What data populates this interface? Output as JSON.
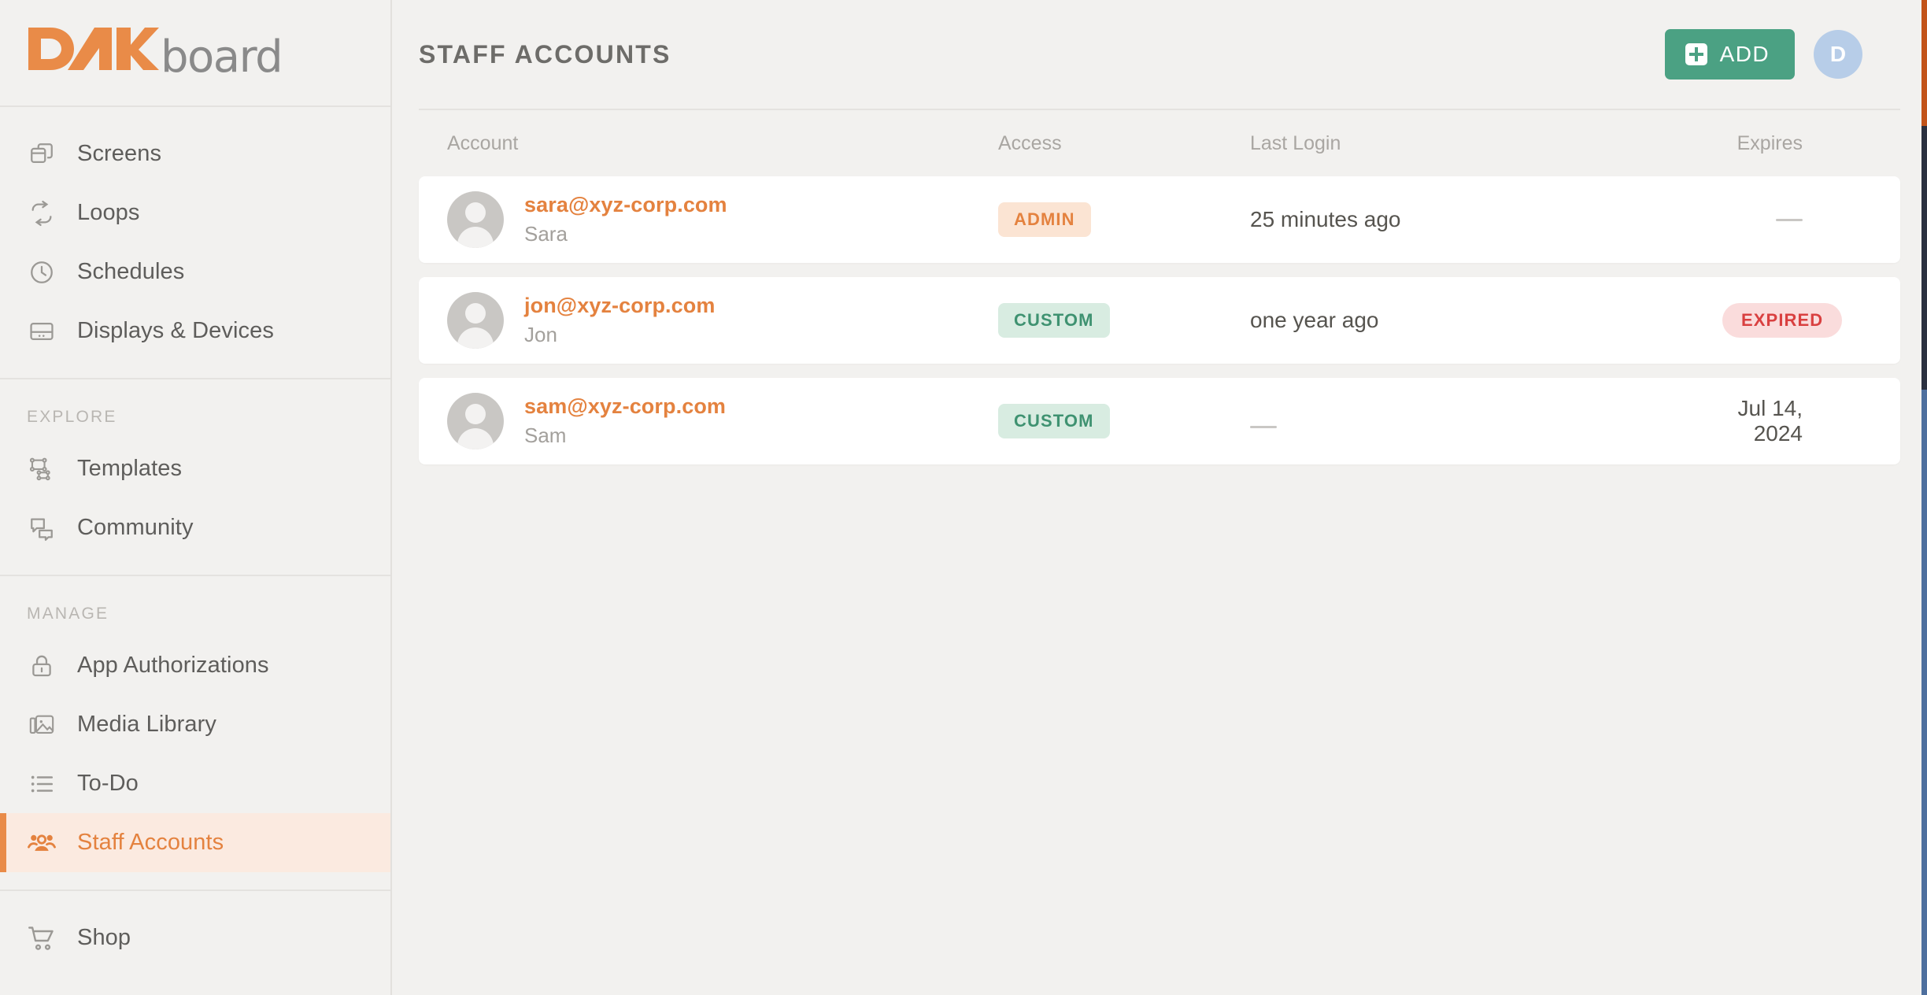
{
  "brand": {
    "mark_text": "DAK",
    "word": "board",
    "accent_color": "#e98b48",
    "word_color": "#8a8a8a"
  },
  "sidebar": {
    "groups": [
      {
        "title": "",
        "items": [
          {
            "label": "Screens",
            "icon": "screens-icon",
            "active": false
          },
          {
            "label": "Loops",
            "icon": "loops-icon",
            "active": false
          },
          {
            "label": "Schedules",
            "icon": "clock-icon",
            "active": false
          },
          {
            "label": "Displays & Devices",
            "icon": "display-icon",
            "active": false
          }
        ]
      },
      {
        "title": "EXPLORE",
        "items": [
          {
            "label": "Templates",
            "icon": "templates-icon",
            "active": false
          },
          {
            "label": "Community",
            "icon": "chat-icon",
            "active": false
          }
        ]
      },
      {
        "title": "MANAGE",
        "items": [
          {
            "label": "App Authorizations",
            "icon": "lock-icon",
            "active": false
          },
          {
            "label": "Media Library",
            "icon": "media-icon",
            "active": false
          },
          {
            "label": "To-Do",
            "icon": "list-icon",
            "active": false
          },
          {
            "label": "Staff Accounts",
            "icon": "people-icon",
            "active": true
          }
        ]
      },
      {
        "title": "",
        "items": [
          {
            "label": "Shop",
            "icon": "cart-icon",
            "active": false
          }
        ]
      }
    ]
  },
  "header": {
    "title": "STAFF ACCOUNTS",
    "add_label": "ADD",
    "add_icon": "plus-square-icon",
    "add_color": "#4ba183",
    "avatar_initial": "D",
    "avatar_color": "#b7cde8"
  },
  "table": {
    "columns": [
      {
        "key": "account",
        "label": "Account"
      },
      {
        "key": "access",
        "label": "Access"
      },
      {
        "key": "lastlogin",
        "label": "Last Login"
      },
      {
        "key": "expires",
        "label": "Expires"
      }
    ],
    "rows": [
      {
        "email": "sara@xyz-corp.com",
        "name": "Sara",
        "access": "ADMIN",
        "access_style": "admin",
        "last_login": "25 minutes ago",
        "last_login_is_dash": false,
        "expires": "",
        "expires_is_dash": true,
        "expires_badge": ""
      },
      {
        "email": "jon@xyz-corp.com",
        "name": "Jon",
        "access": "CUSTOM",
        "access_style": "custom",
        "last_login": "one year ago",
        "last_login_is_dash": false,
        "expires": "",
        "expires_is_dash": false,
        "expires_badge": "EXPIRED"
      },
      {
        "email": "sam@xyz-corp.com",
        "name": "Sam",
        "access": "CUSTOM",
        "access_style": "custom",
        "last_login": "",
        "last_login_is_dash": true,
        "expires": "Jul 14, 2024",
        "expires_is_dash": false,
        "expires_badge": ""
      }
    ]
  },
  "colors": {
    "accent_orange": "#e4823f",
    "green": "#4ba183",
    "badge_admin_bg": "#fbe4d3",
    "badge_custom_bg": "#d8ece1",
    "badge_expired_bg": "#fadcdc",
    "badge_expired_fg": "#d94040",
    "page_bg": "#f2f1ef"
  }
}
